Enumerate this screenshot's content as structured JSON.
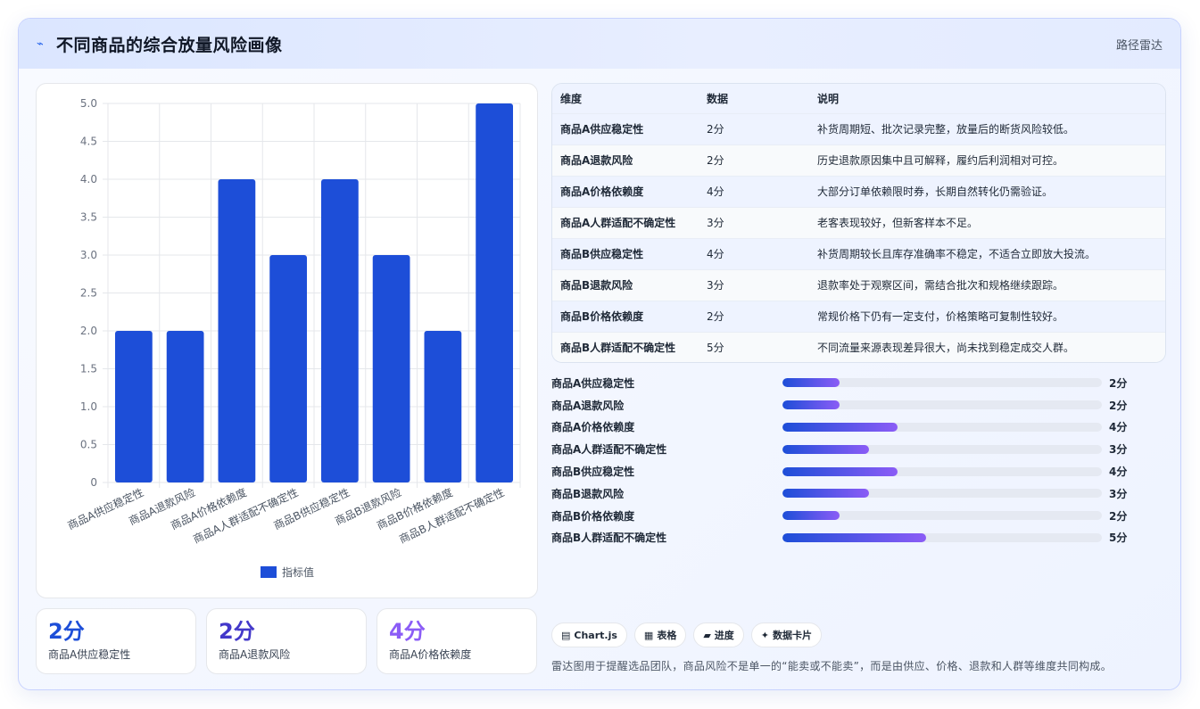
{
  "header": {
    "title": "不同商品的综合放量风险画像",
    "tag": "路径雷达",
    "icon": "pulse-icon"
  },
  "chart_data": {
    "type": "bar",
    "categories": [
      "商品A供应稳定性",
      "商品A退款风险",
      "商品A价格依赖度",
      "商品A人群适配不确定性",
      "商品B供应稳定性",
      "商品B退款风险",
      "商品B价格依赖度",
      "商品B人群适配不确定性"
    ],
    "series": [
      {
        "name": "指标值",
        "values": [
          2,
          2,
          4,
          3,
          4,
          3,
          2,
          5
        ],
        "color": "#1d4ed8"
      }
    ],
    "yticks": [
      "0",
      "0.5",
      "1.0",
      "1.5",
      "2.0",
      "2.5",
      "3.0",
      "3.5",
      "4.0",
      "4.5",
      "5.0"
    ],
    "ylim": [
      0,
      5
    ],
    "grid": true,
    "legend_position": "bottom"
  },
  "stats": [
    {
      "value": "2分",
      "label": "商品A供应稳定性",
      "color": "#1d4ed8"
    },
    {
      "value": "2分",
      "label": "商品A退款风险",
      "color": "#4338ca"
    },
    {
      "value": "4分",
      "label": "商品A价格依赖度",
      "color": "#8b5cf6"
    }
  ],
  "table": {
    "headers": [
      "维度",
      "数据",
      "说明"
    ],
    "rows": [
      [
        "商品A供应稳定性",
        "2分",
        "补货周期短、批次记录完整，放量后的断货风险较低。"
      ],
      [
        "商品A退款风险",
        "2分",
        "历史退款原因集中且可解释，履约后利润相对可控。"
      ],
      [
        "商品A价格依赖度",
        "4分",
        "大部分订单依赖限时券，长期自然转化仍需验证。"
      ],
      [
        "商品A人群适配不确定性",
        "3分",
        "老客表现较好，但新客样本不足。"
      ],
      [
        "商品B供应稳定性",
        "4分",
        "补货周期较长且库存准确率不稳定，不适合立即放大投流。"
      ],
      [
        "商品B退款风险",
        "3分",
        "退款率处于观察区间，需结合批次和规格继续跟踪。"
      ],
      [
        "商品B价格依赖度",
        "2分",
        "常规价格下仍有一定支付，价格策略可复制性较好。"
      ],
      [
        "商品B人群适配不确定性",
        "5分",
        "不同流量来源表现差异很大，尚未找到稳定成交人群。"
      ]
    ]
  },
  "progress": [
    {
      "label": "商品A供应稳定性",
      "value": "2分",
      "fraction": 0.18
    },
    {
      "label": "商品A退款风险",
      "value": "2分",
      "fraction": 0.18
    },
    {
      "label": "商品A价格依赖度",
      "value": "4分",
      "fraction": 0.36
    },
    {
      "label": "商品A人群适配不确定性",
      "value": "3分",
      "fraction": 0.27
    },
    {
      "label": "商品B供应稳定性",
      "value": "4分",
      "fraction": 0.36
    },
    {
      "label": "商品B退款风险",
      "value": "3分",
      "fraction": 0.27
    },
    {
      "label": "商品B价格依赖度",
      "value": "2分",
      "fraction": 0.18
    },
    {
      "label": "商品B人群适配不确定性",
      "value": "5分",
      "fraction": 0.45
    }
  ],
  "pills": [
    {
      "icon": "chart-icon",
      "glyph": "▤",
      "label": "Chart.js"
    },
    {
      "icon": "table-icon",
      "glyph": "▦",
      "label": "表格"
    },
    {
      "icon": "progress-icon",
      "glyph": "▰",
      "label": "进度"
    },
    {
      "icon": "sparkle-icon",
      "glyph": "✦",
      "label": "数据卡片"
    }
  ],
  "note": "雷达图用于提醒选品团队，商品风险不是单一的“能卖或不能卖”，而是由供应、价格、退款和人群等维度共同构成。"
}
